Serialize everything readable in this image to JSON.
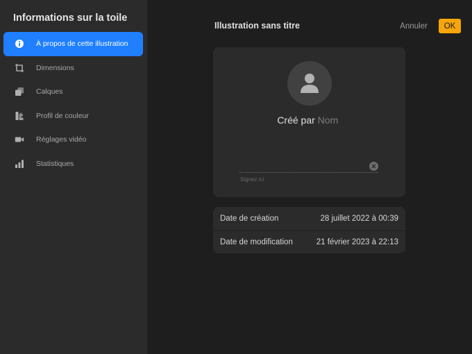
{
  "sidebar": {
    "title": "Informations sur la toile",
    "items": [
      {
        "label": "À propos de cette illustration",
        "icon": "info-icon",
        "active": true
      },
      {
        "label": "Dimensions",
        "icon": "crop-icon",
        "active": false
      },
      {
        "label": "Calques",
        "icon": "layers-icon",
        "active": false
      },
      {
        "label": "Profil de couleur",
        "icon": "color-profile-icon",
        "active": false
      },
      {
        "label": "Réglages vidéo",
        "icon": "video-camera-icon",
        "active": false
      },
      {
        "label": "Statistiques",
        "icon": "bar-chart-icon",
        "active": false
      }
    ]
  },
  "header": {
    "title": "Illustration sans titre",
    "cancel_label": "Annuler",
    "ok_label": "OK"
  },
  "author": {
    "prefix": "Créé par",
    "name_placeholder": "Nom",
    "signature_placeholder": "Signez ici"
  },
  "dates": [
    {
      "label": "Date de création",
      "value": "28 juillet 2022 à 00:39"
    },
    {
      "label": "Date de modification",
      "value": "21 février 2023 à 22:13"
    }
  ],
  "colors": {
    "accent": "#1f7fff",
    "ok_button": "#f6a60a",
    "panel": "#2b2b2b",
    "background": "#1e1e1e"
  }
}
